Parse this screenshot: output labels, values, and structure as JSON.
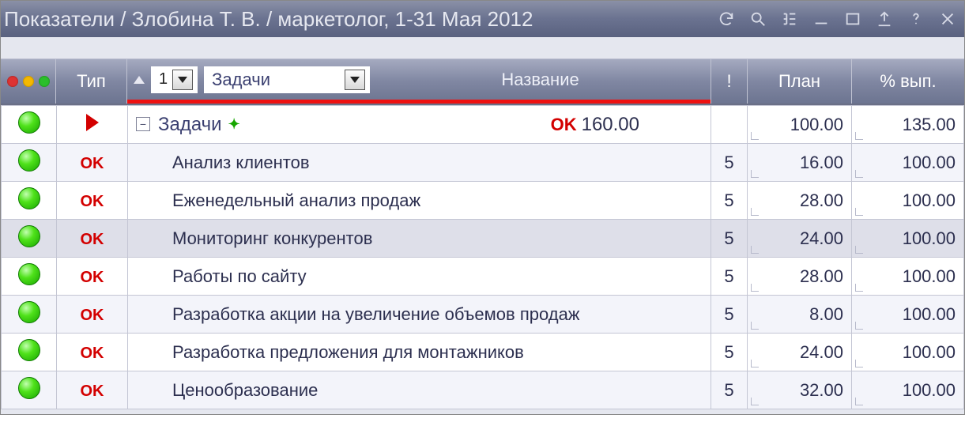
{
  "title": "Показатели / Злобина Т. В. / маркетолог, 1-31 Мая 2012",
  "toolbar_icons": [
    "refresh",
    "search",
    "tree",
    "minimize",
    "maximize",
    "export",
    "help",
    "close"
  ],
  "columns": {
    "type": "Тип",
    "sort_value": "1",
    "category_value": "Задачи",
    "name": "Название",
    "bang": "!",
    "plan": "План",
    "pct": "% вып."
  },
  "parent_row": {
    "label": "Задачи",
    "ok": "OK",
    "value": "160.00",
    "plan": "100.00",
    "pct": "135.00"
  },
  "rows": [
    {
      "type": "OK",
      "name": "Анализ клиентов",
      "bang": "5",
      "plan": "16.00",
      "pct": "100.00",
      "alt": true
    },
    {
      "type": "OK",
      "name": "Еженедельный анализ продаж",
      "bang": "5",
      "plan": "28.00",
      "pct": "100.00",
      "alt": false
    },
    {
      "type": "OK",
      "name": "Мониторинг конкурентов",
      "bang": "5",
      "plan": "24.00",
      "pct": "100.00",
      "alt": false,
      "selected": true
    },
    {
      "type": "OK",
      "name": "Работы по сайту",
      "bang": "5",
      "plan": "28.00",
      "pct": "100.00",
      "alt": false
    },
    {
      "type": "OK",
      "name": "Разработка акции на увеличение объемов продаж",
      "bang": "5",
      "plan": "8.00",
      "pct": "100.00",
      "alt": true
    },
    {
      "type": "OK",
      "name": "Разработка предложения для монтажников",
      "bang": "5",
      "plan": "24.00",
      "pct": "100.00",
      "alt": false
    },
    {
      "type": "OK",
      "name": "Ценообразование",
      "bang": "5",
      "plan": "32.00",
      "pct": "100.00",
      "alt": true
    }
  ]
}
